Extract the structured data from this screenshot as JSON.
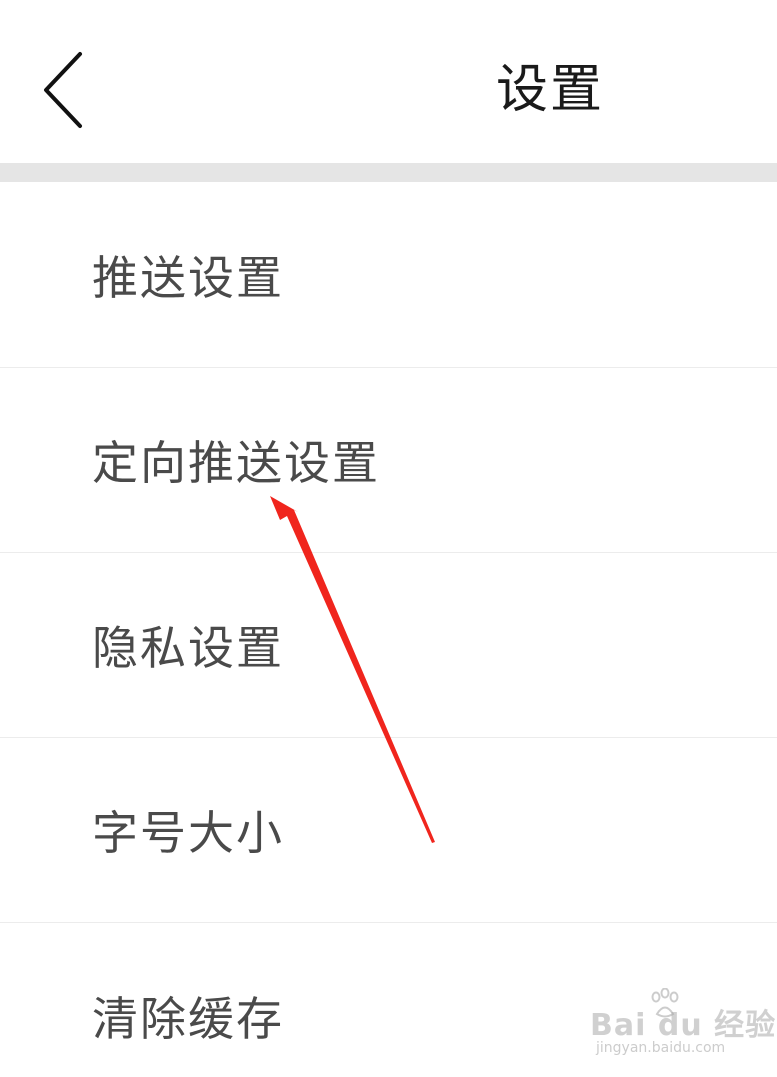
{
  "header": {
    "title": "设置",
    "back_icon": "chevron-left-icon"
  },
  "menu": {
    "items": [
      {
        "label": "推送设置"
      },
      {
        "label": "定向推送设置"
      },
      {
        "label": "隐私设置"
      },
      {
        "label": "字号大小"
      },
      {
        "label": "清除缓存"
      }
    ]
  },
  "annotation": {
    "arrow_color": "#f0251d"
  },
  "watermark": {
    "main_text": "Bai du 经验",
    "sub_text": "jingyan.baidu.com"
  },
  "colors": {
    "divider": "#e5e5e5",
    "item_text": "#4a4a4a",
    "title_text": "#1a1a1a"
  }
}
